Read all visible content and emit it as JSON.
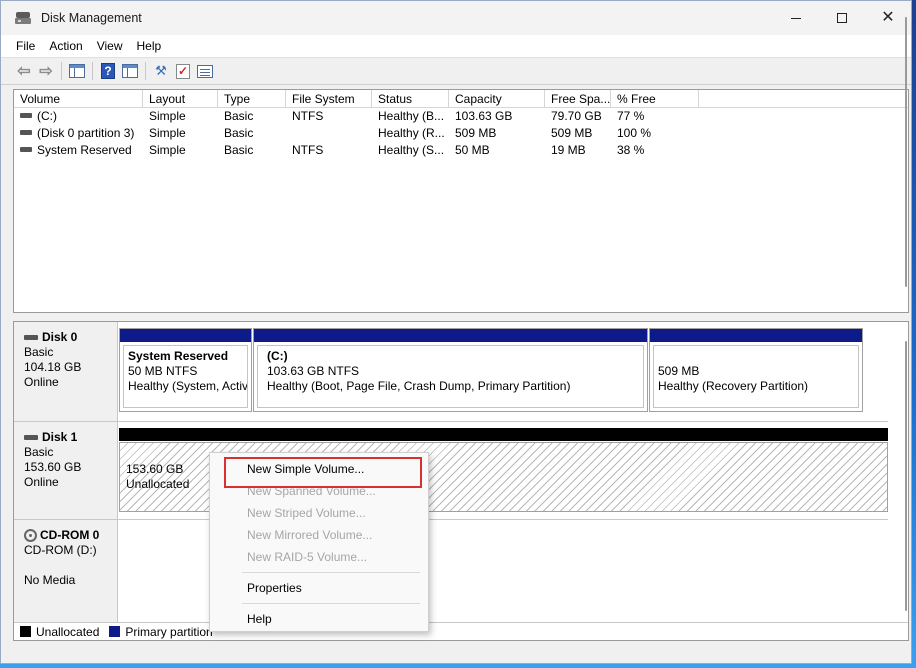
{
  "window": {
    "title": "Disk Management"
  },
  "menu": [
    "File",
    "Action",
    "View",
    "Help"
  ],
  "toolbar": {
    "icons": [
      "back-arrow-icon",
      "forward-arrow-icon",
      "console-tree-icon",
      "help-icon",
      "show-hide-icon",
      "rescan-icon",
      "checklist-icon",
      "properties-icon"
    ]
  },
  "volume_list": {
    "columns": [
      "Volume",
      "Layout",
      "Type",
      "File System",
      "Status",
      "Capacity",
      "Free Spa...",
      "% Free"
    ],
    "rows": [
      [
        "(C:)",
        "Simple",
        "Basic",
        "NTFS",
        "Healthy (B...",
        "103.63 GB",
        "79.70 GB",
        "77 %"
      ],
      [
        "(Disk 0 partition 3)",
        "Simple",
        "Basic",
        "",
        "Healthy (R...",
        "509 MB",
        "509 MB",
        "100 %"
      ],
      [
        "System Reserved",
        "Simple",
        "Basic",
        "NTFS",
        "Healthy (S...",
        "50 MB",
        "19 MB",
        "38 %"
      ]
    ]
  },
  "disks": {
    "disk0": {
      "name": "Disk 0",
      "type": "Basic",
      "size": "104.18 GB",
      "status": "Online",
      "partitions": [
        {
          "title": "System Reserved",
          "line1": "50 MB NTFS",
          "line2": "Healthy (System, Activ"
        },
        {
          "title": "(C:)",
          "line1": "103.63 GB NTFS",
          "line2": "Healthy (Boot, Page File, Crash Dump, Primary Partition)"
        },
        {
          "title": "",
          "line1": "509 MB",
          "line2": "Healthy (Recovery Partition)"
        }
      ]
    },
    "disk1": {
      "name": "Disk 1",
      "type": "Basic",
      "size": "153.60 GB",
      "status": "Online",
      "unallocated_size": "153.60 GB",
      "unallocated_label": "Unallocated"
    },
    "cdrom0": {
      "name": "CD-ROM 0",
      "drive": "CD-ROM (D:)",
      "media": "No Media"
    }
  },
  "legend": {
    "items": [
      {
        "label": "Unallocated",
        "color": "#000000"
      },
      {
        "label": "Primary partition",
        "color": "#0f1a8a"
      }
    ]
  },
  "context_menu": {
    "items": [
      {
        "label": "New Simple Volume...",
        "enabled": true
      },
      {
        "label": "New Spanned Volume...",
        "enabled": false
      },
      {
        "label": "New Striped Volume...",
        "enabled": false
      },
      {
        "label": "New Mirrored Volume...",
        "enabled": false
      },
      {
        "label": "New RAID-5 Volume...",
        "enabled": false
      },
      {
        "label": "Properties",
        "enabled": true
      },
      {
        "label": "Help",
        "enabled": true
      }
    ],
    "highlight_color": "#d93030"
  }
}
